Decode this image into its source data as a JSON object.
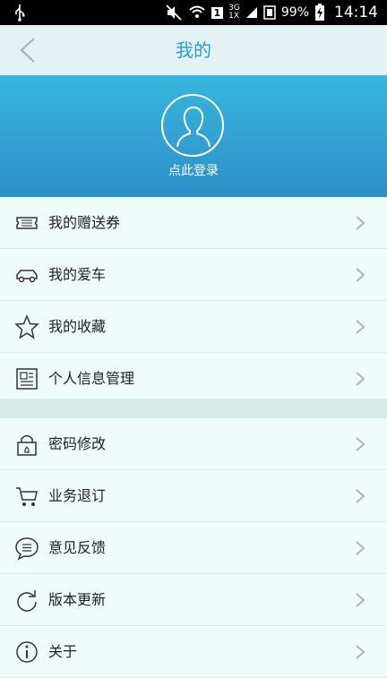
{
  "status_bar": {
    "battery": "99%",
    "time": "14:14",
    "network": [
      "3G",
      "1X"
    ],
    "sim": "1"
  },
  "header": {
    "title": "我的",
    "back_icon": "chevron-left-icon"
  },
  "profile": {
    "login_label": "点此登录",
    "avatar_icon": "user-silhouette-icon"
  },
  "menu_group_1": [
    {
      "label": "我的赠送券",
      "icon": "ticket-icon"
    },
    {
      "label": "我的爱车",
      "icon": "car-icon"
    },
    {
      "label": "我的收藏",
      "icon": "star-icon"
    },
    {
      "label": "个人信息管理",
      "icon": "newspaper-icon"
    }
  ],
  "menu_group_2": [
    {
      "label": "密码修改",
      "icon": "lock-icon"
    },
    {
      "label": "业务退订",
      "icon": "cart-icon"
    },
    {
      "label": "意见反馈",
      "icon": "speech-bubble-icon"
    },
    {
      "label": "版本更新",
      "icon": "refresh-icon"
    },
    {
      "label": "关于",
      "icon": "info-icon"
    }
  ],
  "colors": {
    "accent": "#2a9bd6",
    "header_bg": "#e3f3f4",
    "profile_gradient_top": "#37b6dd",
    "profile_gradient_bottom": "#2f8fc7",
    "list_bg": "#effcfc"
  }
}
